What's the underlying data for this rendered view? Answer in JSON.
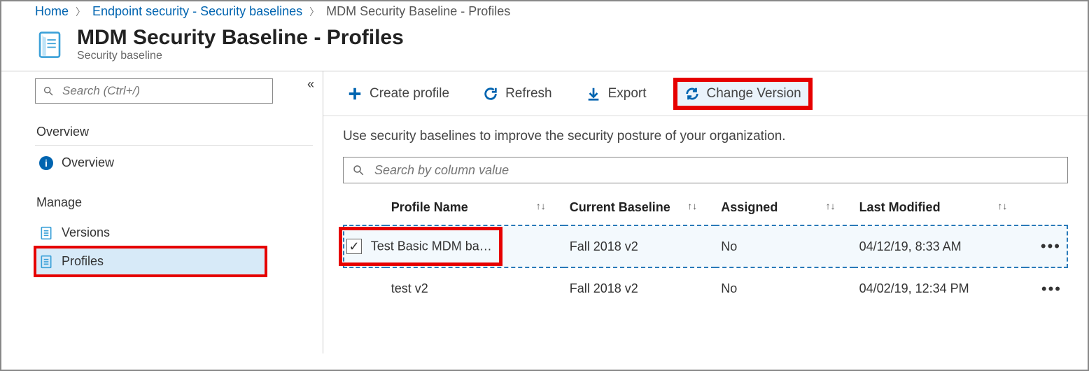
{
  "breadcrumb": {
    "items": [
      "Home",
      "Endpoint security - Security baselines"
    ],
    "current": "MDM Security Baseline - Profiles"
  },
  "header": {
    "title": "MDM Security Baseline - Profiles",
    "subtitle": "Security baseline"
  },
  "sidebar": {
    "search_placeholder": "Search (Ctrl+/)",
    "overview_section": "Overview",
    "manage_section": "Manage",
    "items": {
      "overview": "Overview",
      "versions": "Versions",
      "profiles": "Profiles"
    }
  },
  "toolbar": {
    "create": "Create profile",
    "refresh": "Refresh",
    "export": "Export",
    "change_version": "Change Version"
  },
  "main": {
    "intro": "Use security baselines to improve the security posture of your organization.",
    "col_search_placeholder": "Search by column value",
    "columns": {
      "name": "Profile Name",
      "baseline": "Current Baseline",
      "assigned": "Assigned",
      "modified": "Last Modified"
    },
    "rows": [
      {
        "selected": true,
        "name": "Test Basic MDM ba…",
        "baseline": "Fall 2018 v2",
        "assigned": "No",
        "modified": "04/12/19, 8:33 AM"
      },
      {
        "selected": false,
        "name": "test v2",
        "baseline": "Fall 2018 v2",
        "assigned": "No",
        "modified": "04/02/19, 12:34 PM"
      }
    ]
  }
}
